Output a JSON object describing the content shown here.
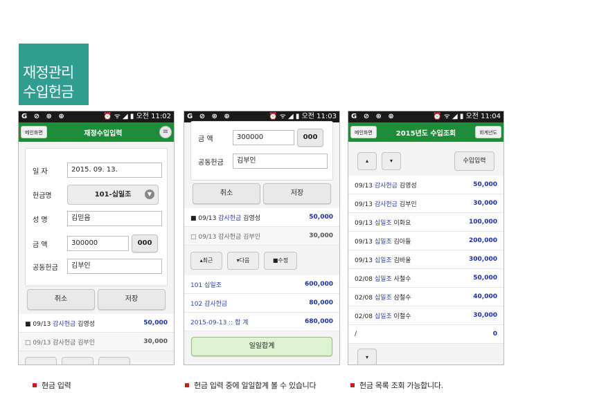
{
  "title": {
    "line1": "재정관리",
    "line2": "수입헌금"
  },
  "status": {
    "icons_left": "G ⊘ ⊛ ⊕",
    "icons_right": "⏰ ᯤ ◢ ▮",
    "time1": "오전 11:02",
    "time2": "오전 11:03",
    "time3": "오전 11:04"
  },
  "phone1": {
    "main_btn": "메인화면",
    "title": "재정수입입력",
    "fields": {
      "date_label": "일 자",
      "date_value": "2015. 09. 13.",
      "type_label": "헌금명",
      "type_value": "101-십일조",
      "name_label": "성 명",
      "name_value": "김믿음",
      "amount_label": "금 액",
      "amount_value": "300000",
      "zeros_btn": "000",
      "joint_label": "공동헌금",
      "joint_value": "김부인"
    },
    "cancel": "취소",
    "save": "저장",
    "list": [
      {
        "prefix": "■ 09/13 ",
        "type": "감사헌금",
        "name": " 김영성",
        "amount": "50,000"
      },
      {
        "prefix": "□ 09/13 감사헌금 김부인",
        "type": "",
        "name": "",
        "amount": "30,000"
      }
    ]
  },
  "phone2": {
    "amount_label": "금 액",
    "amount_value": "300000",
    "zeros_btn": "000",
    "joint_label": "공동헌금",
    "joint_value": "김부인",
    "cancel": "취소",
    "save": "저장",
    "list": [
      {
        "prefix": "■ 09/13 ",
        "type": "감사헌금",
        "name": " 김영성",
        "amount": "50,000"
      },
      {
        "prefix": "□ 09/13 감사헌금 김부인",
        "type": "",
        "name": "",
        "amount": "30,000"
      }
    ],
    "nav": {
      "recent": "▴최근",
      "next": "▾다음",
      "edit": "■수정"
    },
    "totals": [
      {
        "label": "101 십일조",
        "amount": "600,000"
      },
      {
        "label": "102 감사헌금",
        "amount": "80,000"
      },
      {
        "label": "2015-09-13 :: 합 계",
        "amount": "680,000"
      }
    ],
    "daily_total_btn": "일일합계"
  },
  "phone3": {
    "main_btn": "메인화면",
    "title": "2015년도 수입조회",
    "year_btn": "회계년도",
    "up": "▴",
    "down": "▾",
    "income_btn": "수입입력",
    "list": [
      {
        "date": "09/13 ",
        "type": "감사헌금",
        "name": " 김영성",
        "amount": "50,000"
      },
      {
        "date": "09/13 ",
        "type": "감사헌금",
        "name": " 김부인",
        "amount": "30,000"
      },
      {
        "date": "09/13 ",
        "type": "십일조",
        "name": " 이화요",
        "amount": "100,000"
      },
      {
        "date": "09/13 ",
        "type": "십일조",
        "name": " 김아들",
        "amount": "200,000"
      },
      {
        "date": "09/13 ",
        "type": "십일조",
        "name": " 김바울",
        "amount": "300,000"
      },
      {
        "date": "02/08 ",
        "type": "십일조",
        "name": " 사철수",
        "amount": "50,000"
      },
      {
        "date": "02/08 ",
        "type": "십일조",
        "name": " 삼철수",
        "amount": "40,000"
      },
      {
        "date": "02/08 ",
        "type": "십일조",
        "name": " 이철수",
        "amount": "30,000"
      },
      {
        "date": "/",
        "type": "",
        "name": "",
        "amount": "0"
      }
    ]
  },
  "captions": {
    "c1": "현금 입력",
    "c2": "헌금 입력 중에 일일합계 볼 수 있습니다",
    "c3": "헌금 목록 조회 가능합니다."
  },
  "colors": {
    "accent": "#2f9e90",
    "header": "#1f8c3a",
    "amount": "#1a2fa8",
    "bullet": "#d21a1a"
  }
}
